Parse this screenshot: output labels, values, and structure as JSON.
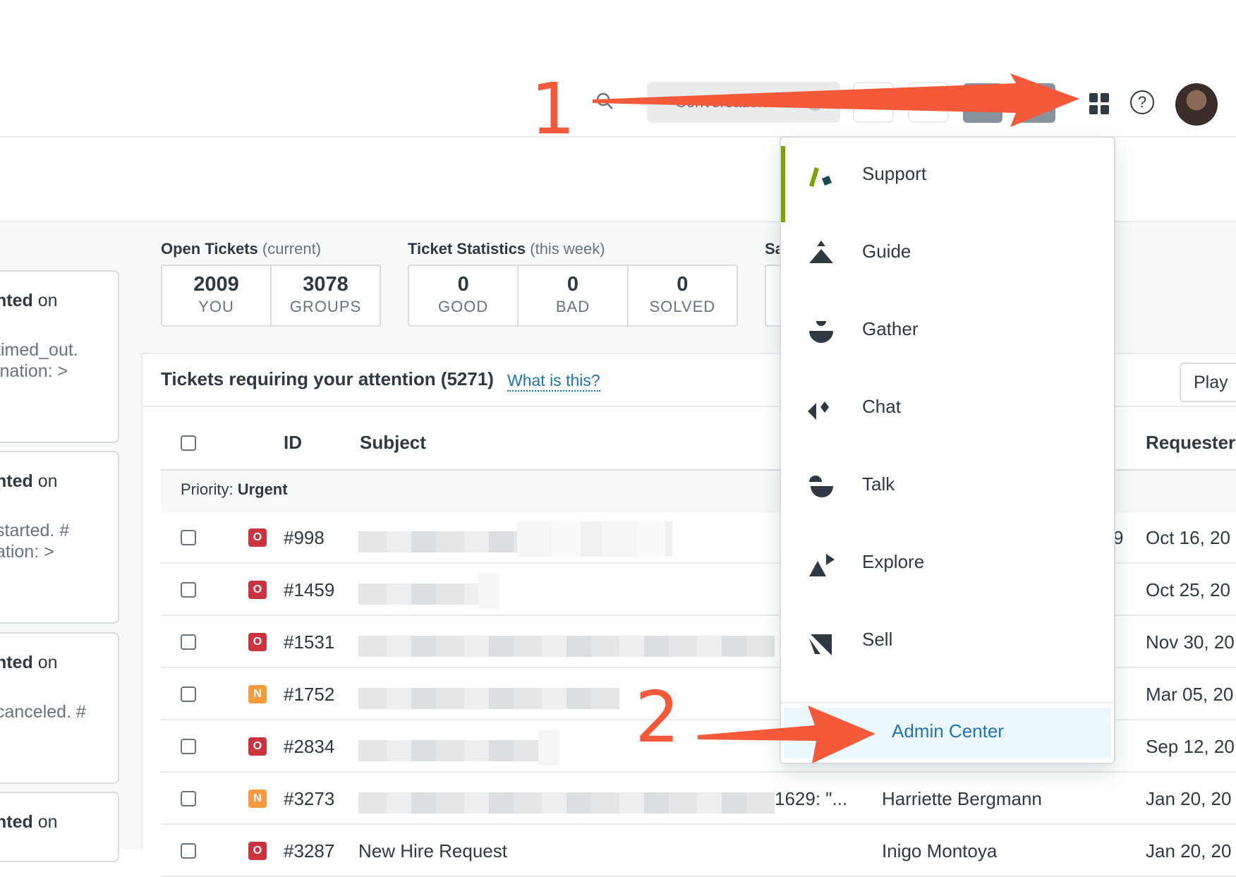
{
  "topbar": {
    "conversations_label": "Conversations",
    "help_glyph": "?"
  },
  "left_cards": [
    {
      "bold": "nted",
      "tail": " on",
      "lines": [
        "timed_out.",
        "ination: >"
      ]
    },
    {
      "bold": "nted",
      "tail": " on",
      "lines": [
        "started. #",
        "ation: >"
      ]
    },
    {
      "bold": "nted",
      "tail": " on",
      "lines": [
        "canceled. #"
      ]
    },
    {
      "bold": "nted",
      "tail": " on",
      "lines": []
    }
  ],
  "stats": {
    "open_title": "Open Tickets",
    "open_sub": "(current)",
    "open": [
      {
        "num": "2009",
        "label": "YOU"
      },
      {
        "num": "3078",
        "label": "GROUPS"
      }
    ],
    "stats_title": "Ticket Statistics",
    "stats_sub": "(this week)",
    "week": [
      {
        "num": "0",
        "label": "GOOD"
      },
      {
        "num": "0",
        "label": "BAD"
      },
      {
        "num": "0",
        "label": "SOLVED"
      }
    ],
    "third_title_partial": "Sa"
  },
  "attention": {
    "title": "Tickets requiring your attention (5271)",
    "what_is_this": "What is this?",
    "play_label": "Play"
  },
  "table": {
    "headers": {
      "id": "ID",
      "subject": "Subject",
      "requester": "Requester"
    },
    "priority_prefix": "Priority:",
    "priority_value": "Urgent",
    "rows": [
      {
        "badge": "O",
        "id": "#998",
        "subject": "",
        "extra": "9",
        "requester": "",
        "date": "Oct 16, 20"
      },
      {
        "badge": "O",
        "id": "#1459",
        "subject": "",
        "extra": "",
        "requester": "",
        "date": "Oct 25, 20"
      },
      {
        "badge": "O",
        "id": "#1531",
        "subject": "",
        "extra": "",
        "requester": "",
        "date": "Nov 30, 20"
      },
      {
        "badge": "N",
        "id": "#1752",
        "subject": "",
        "extra": "",
        "requester": "",
        "date": "Mar 05, 20"
      },
      {
        "badge": "O",
        "id": "#2834",
        "subject": "",
        "extra": "",
        "requester": "",
        "date": "Sep 12, 20"
      },
      {
        "badge": "N",
        "id": "#3273",
        "subject": "",
        "extra": "1629: \"...",
        "requester": "Harriette Bergmann",
        "date": "Jan 20, 20"
      },
      {
        "badge": "O",
        "id": "#3287",
        "subject": "New Hire Request",
        "extra": "",
        "requester": "Inigo Montoya",
        "date": "Jan 20, 20"
      }
    ]
  },
  "product_menu": {
    "items": [
      {
        "label": "Support",
        "icon": "support-icon",
        "active": true
      },
      {
        "label": "Guide",
        "icon": "guide-icon"
      },
      {
        "label": "Gather",
        "icon": "gather-icon"
      },
      {
        "label": "Chat",
        "icon": "chat-icon"
      },
      {
        "label": "Talk",
        "icon": "talk-icon"
      },
      {
        "label": "Explore",
        "icon": "explore-icon"
      },
      {
        "label": "Sell",
        "icon": "sell-icon"
      }
    ],
    "admin_label": "Admin Center"
  },
  "annotations": {
    "step1": "1",
    "step2": "2",
    "color": "#f45a3a"
  },
  "colors": {
    "accent": "#1f73b7",
    "support_green": "#78a300",
    "badge_open": "#cc3340",
    "badge_new": "#f79a3e"
  }
}
